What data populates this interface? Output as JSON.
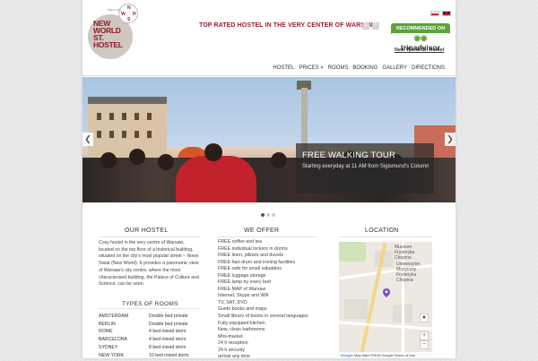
{
  "header": {
    "logo_text_lines": [
      "NEW",
      "WORLD",
      "ST.",
      "HOSTEL"
    ],
    "badge_small_text": "Patron Org",
    "badge_letters": [
      "N",
      "W",
      "H",
      "S"
    ],
    "tagline": "TOP RATED HOSTEL IN THE VERY CENTER OF WARSAW",
    "tripadvisor": {
      "recommended": "RECOMMENDED ON",
      "brand": "tripadvisor",
      "link": "New World St. Hostel"
    },
    "nav": [
      "HOSTEL",
      "PRICES »",
      "ROOMS",
      "BOOKING",
      "GALLERY",
      "DIRECTIONS"
    ]
  },
  "slider": {
    "caption_title": "FREE WALKING TOUR",
    "caption_text": "Starting everyday at 11 AM from Sigismund's Column",
    "prev": "❮",
    "next": "❯"
  },
  "our_hostel": {
    "title": "OUR HOSTEL",
    "text": "Cosy hostel in the very centre of Warsaw, located on the top floor of a historical building, situated on the city's most popular street – Nowy Swiat (New World). It provides a panoramic view of Warsaw's city centre, where the most characterised building, the Palace of Culture and Science, can be seen."
  },
  "rooms": {
    "title": "TYPES OF ROOMS",
    "list": [
      {
        "name": "AMSTERDAM",
        "type": "Double bed private"
      },
      {
        "name": "BERLIN",
        "type": "Double bed private"
      },
      {
        "name": "ROME",
        "type": "4 bed mixed dorm"
      },
      {
        "name": "BARCELONA",
        "type": "4 bed mixed dorm"
      },
      {
        "name": "SYDNEY",
        "type": "8 bed mixed dorm"
      },
      {
        "name": "NEW YORK",
        "type": "10 bed mixed dorm"
      }
    ]
  },
  "we_offer": {
    "title": "WE OFFER",
    "items": [
      "FREE coffee and tea",
      "FREE individual lockers in dorms",
      "FREE linen, pillows and duvets",
      "FREE hair-dryer and ironing facilities",
      "FREE safe for small valuables",
      "FREE luggage storage",
      "FREE lamp by every bed",
      "FREE MAP of Warsaw",
      "Internet, Skype and Wifi",
      "TV, SAT, DVD",
      "Guide books and maps",
      "Small library of books in several languages",
      "Fully equipped kitchen",
      "New, clean bathrooms",
      "Mini-market",
      "24 h reception",
      "24 h security",
      "arrival any time"
    ]
  },
  "location": {
    "title": "LOCATION",
    "labels": {
      "museum": "Muzeum Fryderyka Chopina",
      "university": "Uniwersytet Muzyczny Fryderyka Chopina"
    },
    "map_data": "Map data ©2016 Google",
    "terms": "Terms of Use"
  },
  "colors": {
    "brand": "#9b1c32",
    "tripadvisor_green": "#59a535"
  }
}
